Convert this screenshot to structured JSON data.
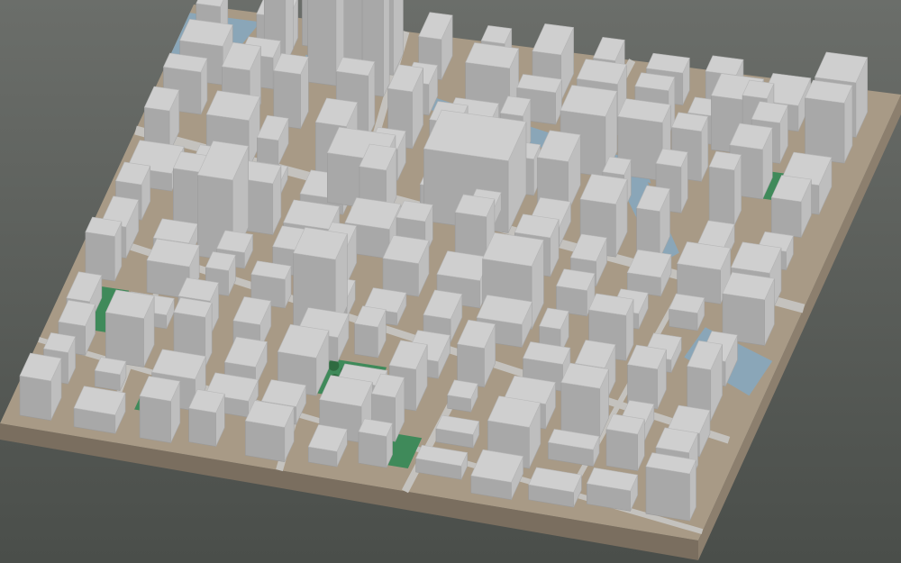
{
  "scene": {
    "subject": "3d-city-block-model",
    "colors": {
      "background_top": "#6b6e6a",
      "background_bottom": "#4a4e4a",
      "ground": "#a89a86",
      "base_side": "#8c7f6e",
      "base_front": "#7a6e5f",
      "building_top": "#cfcfcf",
      "building_left": "#a8a8a8",
      "building_right": "#bebebe",
      "water": "#8aa6b8",
      "park": "#3f8a5a",
      "tree": "#2f6b40",
      "road": "#c4c2be"
    }
  }
}
